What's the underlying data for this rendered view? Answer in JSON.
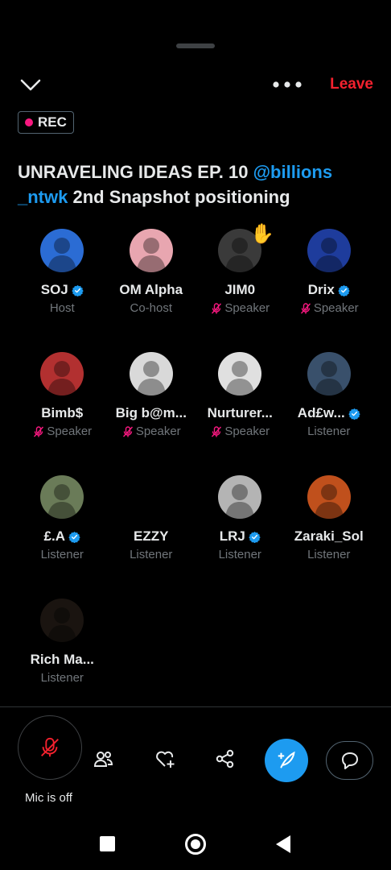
{
  "header": {
    "leave_label": "Leave",
    "rec_label": "REC"
  },
  "space": {
    "title_part1": "UNRAVELING IDEAS EP. 10 ",
    "title_mention": "@billions _ntwk",
    "title_part2": " 2nd Snapshot positioning"
  },
  "participants": [
    {
      "name": "SOJ",
      "role": "Host",
      "verified": true,
      "muted": false,
      "color": "#2b6cd4"
    },
    {
      "name": "OM Alpha",
      "role": "Co-host",
      "verified": false,
      "muted": false,
      "color": "#e8a6b0"
    },
    {
      "name": "JIM0",
      "role": "Speaker",
      "verified": false,
      "muted": true,
      "hand": "✋",
      "color": "#3a3a3a"
    },
    {
      "name": "Drix",
      "role": "Speaker",
      "verified": true,
      "muted": true,
      "color": "#1e3c9c"
    },
    {
      "name": "Bimb$",
      "role": "Speaker",
      "verified": false,
      "muted": true,
      "color": "#b23030"
    },
    {
      "name": "Big b@m...",
      "role": "Speaker",
      "verified": false,
      "muted": true,
      "color": "#d9d9d9"
    },
    {
      "name": "Nurturer...",
      "role": "Speaker",
      "verified": false,
      "muted": true,
      "color": "#e0e0e0"
    },
    {
      "name": "Ad£w...",
      "role": "Listener",
      "verified": true,
      "muted": false,
      "color": "#39506b"
    },
    {
      "name": "£.A",
      "role": "Listener",
      "verified": true,
      "muted": false,
      "color": "#6a7b58"
    },
    {
      "name": "EZZY",
      "role": "Listener",
      "verified": false,
      "muted": false,
      "color": "#000000"
    },
    {
      "name": "LRJ",
      "role": "Listener",
      "verified": true,
      "muted": false,
      "color": "#b4b4b4"
    },
    {
      "name": "Zaraki_Sol",
      "role": "Listener",
      "verified": false,
      "muted": false,
      "color": "#c0501c"
    },
    {
      "name": "Rich Ma...",
      "role": "Listener",
      "verified": false,
      "muted": false,
      "color": "#1a1410"
    }
  ],
  "controls": {
    "mic_label": "Mic is off"
  },
  "colors": {
    "accent": "#1d9bf0",
    "leave": "#f4212e",
    "rec_dot": "#f91880",
    "mic_off": "#f4212e",
    "muted_icon": "#f91880"
  }
}
